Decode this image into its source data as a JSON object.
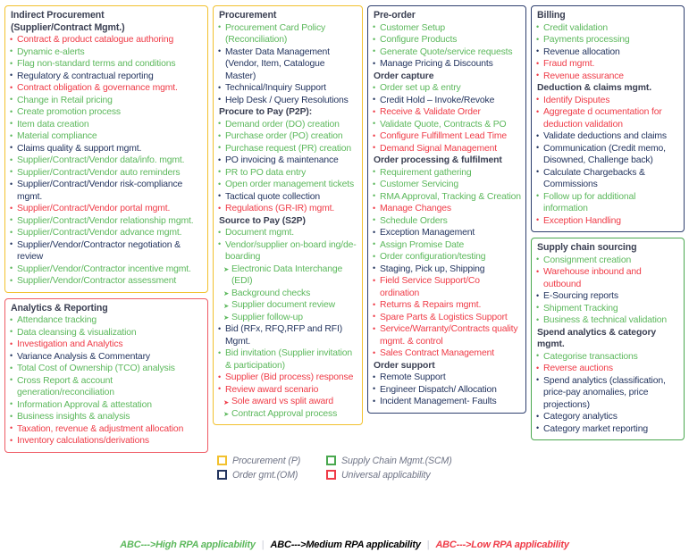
{
  "columns": [
    {
      "name": "column-one",
      "cards": [
        {
          "id": "indirect-procurement",
          "border": "gold",
          "title": "Indirect Procurement",
          "title2": "(Supplier/Contract Mgmt.)",
          "items": [
            {
              "text": "Contract & product catalogue authoring",
              "level": "low"
            },
            {
              "text": "Dynamic e-alerts",
              "level": "high"
            },
            {
              "text": "Flag non-standard terms and conditions",
              "level": "high"
            },
            {
              "text": "Regulatory & contractual reporting",
              "level": "medium"
            },
            {
              "text": "Contract obligation & governance mgmt.",
              "level": "low"
            },
            {
              "text": "Change in Retail pricing",
              "level": "high"
            },
            {
              "text": "Create promotion process",
              "level": "high"
            },
            {
              "text": "Item data creation",
              "level": "high"
            },
            {
              "text": "Material compliance",
              "level": "high"
            },
            {
              "text": "Claims quality & support mgmt.",
              "level": "medium"
            },
            {
              "text": "Supplier/Contract/Vendor data/info. mgmt.",
              "level": "high"
            },
            {
              "text": "Supplier/Contract/Vendor auto reminders",
              "level": "high"
            },
            {
              "text": "Supplier/Contract/Vendor risk-compliance mgmt.",
              "level": "medium"
            },
            {
              "text": "Supplier/Contract/Vendor portal mgmt.",
              "level": "low"
            },
            {
              "text": "Supplier/Contract/Vendor relationship mgmt.",
              "level": "high"
            },
            {
              "text": "Supplier/Contract/Vendor advance mgmt.",
              "level": "high"
            },
            {
              "text": "Supplier/Vendor/Contractor negotiation & review",
              "level": "medium"
            },
            {
              "text": "Supplier/Vendor/Contractor incentive mgmt.",
              "level": "high"
            },
            {
              "text": "Supplier/Vendor/Contractor assessment",
              "level": "high"
            }
          ]
        },
        {
          "id": "analytics-reporting",
          "border": "red",
          "title": "Analytics & Reporting",
          "items": [
            {
              "text": "Attendance tracking",
              "level": "high"
            },
            {
              "text": "Data cleansing & visualization",
              "level": "high"
            },
            {
              "text": "Investigation and Analytics",
              "level": "low"
            },
            {
              "text": "Variance Analysis & Commentary",
              "level": "medium"
            },
            {
              "text": "Total Cost of Ownership (TCO) analysis",
              "level": "high"
            },
            {
              "text": "Cross Report & account generation/reconciliation",
              "level": "high"
            },
            {
              "text": "Information Approval & attestation",
              "level": "high"
            },
            {
              "text": "Business insights & analysis",
              "level": "high"
            },
            {
              "text": "Taxation, revenue & adjustment allocation",
              "level": "low"
            },
            {
              "text": "Inventory calculations/derivations",
              "level": "low"
            }
          ]
        }
      ]
    },
    {
      "name": "column-two",
      "cards": [
        {
          "id": "procurement",
          "border": "gold",
          "title": "Procurement",
          "blocks": [
            {
              "items": [
                {
                  "text": "Procurement Card Policy (Reconciliation)",
                  "level": "high"
                },
                {
                  "text": "Master Data Management (Vendor, Item, Catalogue Master)",
                  "level": "medium"
                },
                {
                  "text": "Technical/Inquiry Support",
                  "level": "medium"
                },
                {
                  "text": "Help Desk / Query Resolutions",
                  "level": "medium"
                }
              ]
            },
            {
              "heading": "Procure to Pay (P2P):",
              "items": [
                {
                  "text": "Demand order (DO) creation",
                  "level": "high"
                },
                {
                  "text": "Purchase order (PO) creation",
                  "level": "high"
                },
                {
                  "text": "Purchase request (PR) creation",
                  "level": "high"
                },
                {
                  "text": "PO invoicing & maintenance",
                  "level": "medium"
                },
                {
                  "text": "PR to PO data entry",
                  "level": "high"
                },
                {
                  "text": "Open order management tickets",
                  "level": "high"
                },
                {
                  "text": "Tactical quote collection",
                  "level": "medium"
                },
                {
                  "text": "Regulations (GR-IR) mgmt.",
                  "level": "low"
                }
              ]
            },
            {
              "heading": "Source to Pay (S2P)",
              "items": [
                {
                  "text": "Document mgmt.",
                  "level": "high"
                },
                {
                  "text": "Vendor/supplier on-board ing/de-boarding",
                  "level": "high"
                },
                {
                  "text": "Electronic Data Interchange (EDI)",
                  "level": "high",
                  "sub": true
                },
                {
                  "text": "Background checks",
                  "level": "high",
                  "sub": true
                },
                {
                  "text": "Supplier document review",
                  "level": "high",
                  "sub": true
                },
                {
                  "text": "Supplier follow-up",
                  "level": "high",
                  "sub": true
                },
                {
                  "text": "Bid (RFx, RFQ,RFP and RFI) Mgmt.",
                  "level": "medium"
                },
                {
                  "text": "Bid invitation (Supplier invitation & participation)",
                  "level": "high"
                },
                {
                  "text": "Supplier (Bid process) response",
                  "level": "low"
                },
                {
                  "text": "Review award scenario",
                  "level": "low"
                },
                {
                  "text": "Sole award vs split award",
                  "level": "low",
                  "sub": true
                },
                {
                  "text": "Contract Approval process",
                  "level": "high",
                  "sub": true
                }
              ]
            }
          ]
        }
      ]
    },
    {
      "name": "column-three",
      "cards": [
        {
          "id": "pre-order",
          "border": "navy",
          "title": "Pre-order",
          "blocks": [
            {
              "items": [
                {
                  "text": "Customer Setup",
                  "level": "high"
                },
                {
                  "text": "Configure Products",
                  "level": "high"
                },
                {
                  "text": "Generate Quote/service requests",
                  "level": "high"
                },
                {
                  "text": "Manage Pricing & Discounts",
                  "level": "medium"
                }
              ]
            },
            {
              "heading": "Order capture",
              "items": [
                {
                  "text": "Order set up & entry",
                  "level": "high"
                },
                {
                  "text": "Credit Hold – Invoke/Revoke",
                  "level": "medium"
                },
                {
                  "text": "Receive & Validate Order",
                  "level": "low"
                },
                {
                  "text": "Validate Quote, Contracts & PO",
                  "level": "high"
                },
                {
                  "text": "Configure Fulfillment Lead Time",
                  "level": "low"
                },
                {
                  "text": "Demand Signal Management",
                  "level": "low"
                }
              ]
            },
            {
              "heading": "Order processing & fulfilment",
              "items": [
                {
                  "text": "Requirement gathering",
                  "level": "high"
                },
                {
                  "text": "Customer Servicing",
                  "level": "high"
                },
                {
                  "text": "RMA Approval, Tracking & Creation",
                  "level": "high"
                },
                {
                  "text": "Manage Changes",
                  "level": "low"
                },
                {
                  "text": "Schedule Orders",
                  "level": "high"
                },
                {
                  "text": "Exception Management",
                  "level": "medium"
                },
                {
                  "text": "Assign Promise Date",
                  "level": "high"
                },
                {
                  "text": "Order configuration/testing",
                  "level": "high"
                },
                {
                  "text": "Staging, Pick up, Shipping",
                  "level": "medium"
                },
                {
                  "text": "Field Service Support/Co ordination",
                  "level": "low"
                },
                {
                  "text": "Returns & Repairs mgmt.",
                  "level": "low"
                },
                {
                  "text": "Spare Parts & Logistics Support",
                  "level": "low"
                },
                {
                  "text": "Service/Warranty/Contracts quality mgmt. & control",
                  "level": "low"
                },
                {
                  "text": "Sales Contract Management",
                  "level": "low"
                }
              ]
            },
            {
              "heading": "Order support",
              "items": [
                {
                  "text": "Remote Support",
                  "level": "medium"
                },
                {
                  "text": "Engineer Dispatch/ Allocation",
                  "level": "medium"
                },
                {
                  "text": "Incident Management- Faults",
                  "level": "medium"
                }
              ]
            }
          ]
        }
      ]
    },
    {
      "name": "column-four",
      "cards": [
        {
          "id": "billing",
          "border": "navy",
          "title": "Billing",
          "blocks": [
            {
              "items": [
                {
                  "text": "Credit validation",
                  "level": "high"
                },
                {
                  "text": "Payments processing",
                  "level": "high"
                },
                {
                  "text": "Revenue allocation",
                  "level": "medium"
                },
                {
                  "text": "Fraud mgmt.",
                  "level": "low"
                },
                {
                  "text": "Revenue assurance",
                  "level": "low"
                }
              ]
            },
            {
              "heading": "Deduction & claims mgmt.",
              "items": [
                {
                  "text": "Identify Disputes",
                  "level": "low"
                },
                {
                  "text": "Aggregate d ocumentation for deduction validation",
                  "level": "low"
                },
                {
                  "text": "Validate deductions and claims",
                  "level": "medium"
                },
                {
                  "text": "Communication (Credit memo, Disowned, Challenge back)",
                  "level": "medium"
                },
                {
                  "text": "Calculate Chargebacks & Commissions",
                  "level": "medium"
                },
                {
                  "text": "Follow up for additional information",
                  "level": "high"
                },
                {
                  "text": "Exception Handling",
                  "level": "low"
                }
              ]
            }
          ]
        },
        {
          "id": "supply-chain-sourcing",
          "border": "green",
          "title": "Supply chain sourcing",
          "blocks": [
            {
              "items": [
                {
                  "text": "Consignment creation",
                  "level": "high"
                },
                {
                  "text": "Warehouse inbound and outbound",
                  "level": "low"
                },
                {
                  "text": "E-Sourcing reports",
                  "level": "medium"
                },
                {
                  "text": "Shipment Tracking",
                  "level": "high"
                },
                {
                  "text": "Business & technical validation",
                  "level": "high"
                }
              ]
            },
            {
              "heading": "Spend analytics & category mgmt.",
              "items": [
                {
                  "text": "Categorise transactions",
                  "level": "high"
                },
                {
                  "text": "Reverse auctions",
                  "level": "low"
                },
                {
                  "text": "Spend analytics (classification, price-pay anomalies, price projections)",
                  "level": "medium"
                },
                {
                  "text": "Category analytics",
                  "level": "medium"
                },
                {
                  "text": "Category market reporting",
                  "level": "medium"
                }
              ]
            }
          ]
        }
      ]
    }
  ],
  "legend": {
    "swatches": [
      {
        "label": "Procurement (P)",
        "color_key": "gold",
        "color": "#f2c12e"
      },
      {
        "label": "Supply Chain Mgmt.(SCM)",
        "color_key": "green",
        "color": "#4aa84f"
      },
      {
        "label": "Order gmt.(OM)",
        "color_key": "navy",
        "color": "#24355f"
      },
      {
        "label": "Universal applicability",
        "color_key": "red",
        "color": "#ef3b47"
      }
    ],
    "rpa": [
      {
        "label": "ABC--->High RPA applicability",
        "color": "#5cb85c",
        "key": "high"
      },
      {
        "label": "ABC--->Medium RPA applicability",
        "color": "#24355f",
        "key": "medium"
      },
      {
        "label": "ABC--->Low RPA applicability",
        "color": "#ef3b47",
        "key": "low"
      }
    ],
    "separator": "|"
  }
}
